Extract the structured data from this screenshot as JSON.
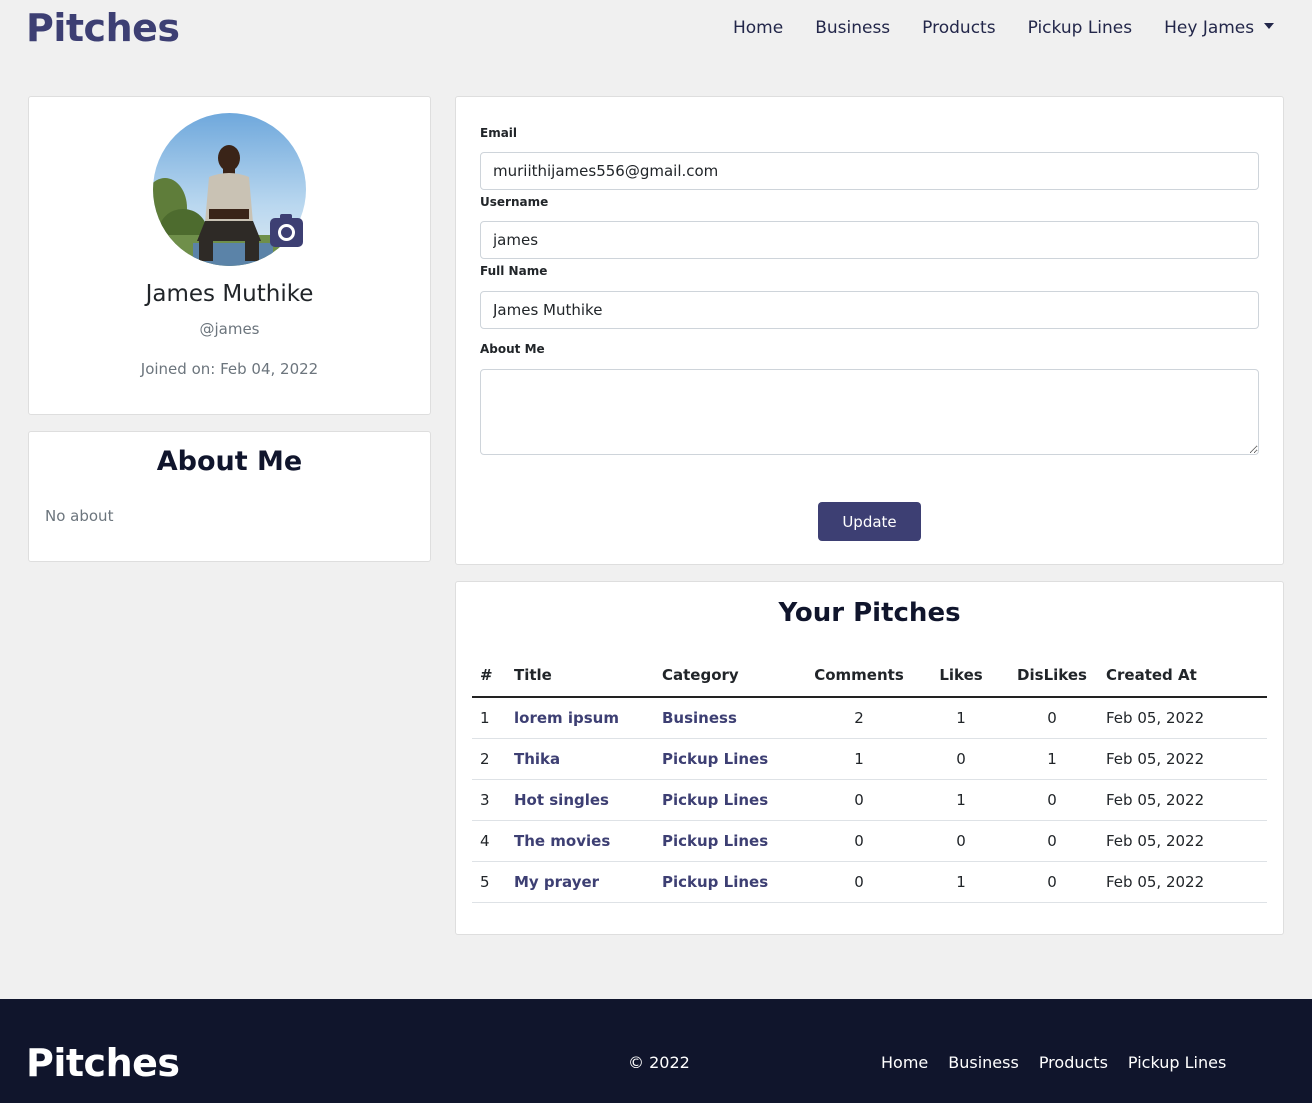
{
  "nav": {
    "brand": "Pitches",
    "links": [
      "Home",
      "Business",
      "Products",
      "Pickup Lines"
    ],
    "user_menu": "Hey James"
  },
  "profile": {
    "full_name": "James Muthike",
    "username": "@james",
    "joined": "Joined on: Feb 04, 2022"
  },
  "about": {
    "title": "About Me",
    "text": "No about"
  },
  "form": {
    "email_label": "Email",
    "email_value": "muriithijames556@gmail.com",
    "username_label": "Username",
    "username_value": "james",
    "fullname_label": "Full Name",
    "fullname_value": "James Muthike",
    "about_label": "About Me",
    "about_value": "",
    "update_label": "Update"
  },
  "pitches": {
    "title": "Your Pitches",
    "headers": [
      "#",
      "Title",
      "Category",
      "Comments",
      "Likes",
      "DisLikes",
      "Created At"
    ],
    "rows": [
      {
        "num": "1",
        "title": "lorem ipsum",
        "category": "Business",
        "comments": "2",
        "likes": "1",
        "dislikes": "0",
        "created": "Feb 05, 2022"
      },
      {
        "num": "2",
        "title": "Thika",
        "category": "Pickup Lines",
        "comments": "1",
        "likes": "0",
        "dislikes": "1",
        "created": "Feb 05, 2022"
      },
      {
        "num": "3",
        "title": "Hot singles",
        "category": "Pickup Lines",
        "comments": "0",
        "likes": "1",
        "dislikes": "0",
        "created": "Feb 05, 2022"
      },
      {
        "num": "4",
        "title": "The movies",
        "category": "Pickup Lines",
        "comments": "0",
        "likes": "0",
        "dislikes": "0",
        "created": "Feb 05, 2022"
      },
      {
        "num": "5",
        "title": "My prayer",
        "category": "Pickup Lines",
        "comments": "0",
        "likes": "1",
        "dislikes": "0",
        "created": "Feb 05, 2022"
      }
    ]
  },
  "footer": {
    "brand": "Pitches",
    "copyright": "© 2022",
    "links": [
      "Home",
      "Business",
      "Products",
      "Pickup Lines"
    ]
  },
  "colors": {
    "primary": "#3d3f73",
    "footer_bg": "#10152c",
    "page_bg": "#f0f0f0"
  },
  "icons": {
    "camera": "camera-icon",
    "caret": "caret-down-icon"
  }
}
